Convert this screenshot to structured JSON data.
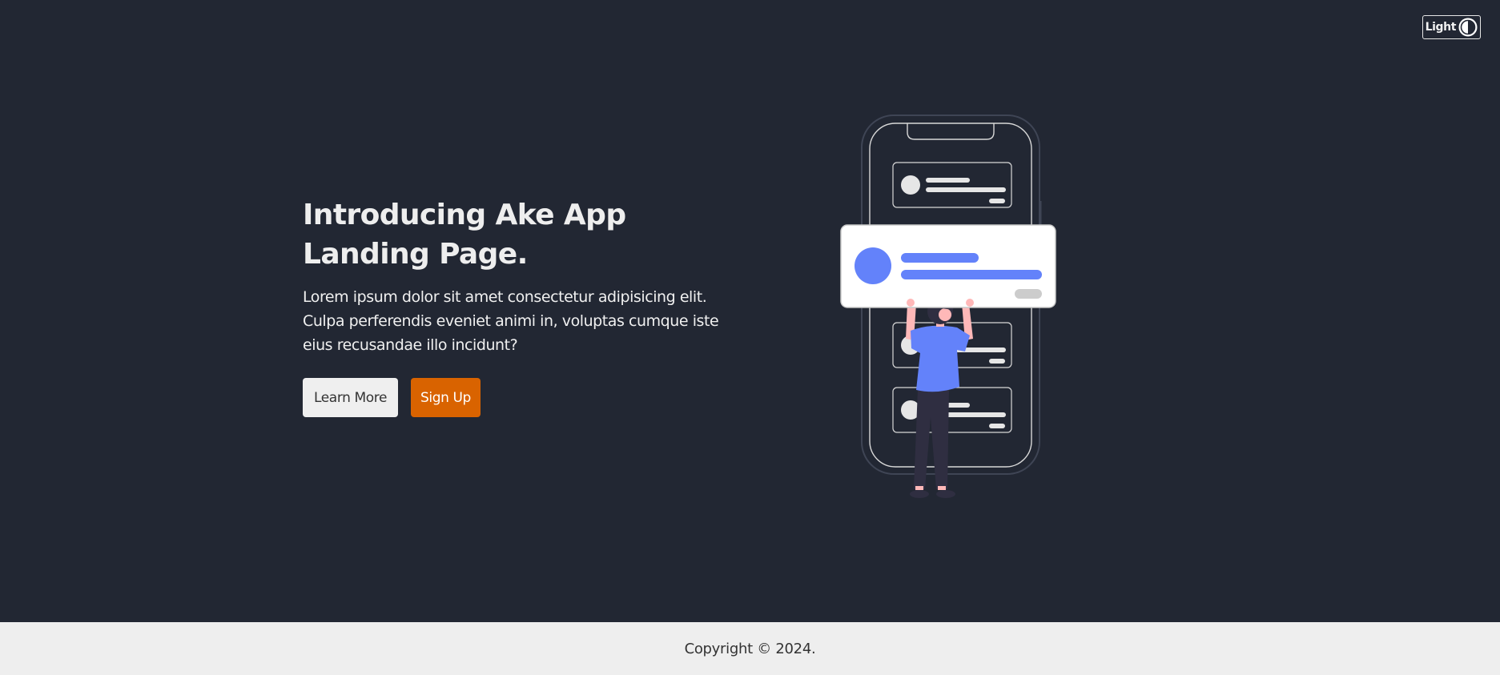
{
  "theme_toggle": {
    "label": "Light",
    "icon": "contrast-icon"
  },
  "hero": {
    "title_line1": "Introducing Ake App",
    "title_line2": "Landing Page.",
    "description": "Lorem ipsum dolor sit amet consectetur adipisicing elit. Culpa perferendis eveniet animi in, voluptas cumque iste eius recusandae illo incidunt?",
    "buttons": {
      "learn_more": "Learn More",
      "sign_up": "Sign Up"
    }
  },
  "illustration": {
    "icon": "phone-person-illustration"
  },
  "footer": {
    "copyright": "Copyright © 2024."
  },
  "colors": {
    "background": "#222733",
    "accent": "#d96300",
    "illustration_blue": "#6382fa",
    "footer_background": "#eeeeee"
  }
}
